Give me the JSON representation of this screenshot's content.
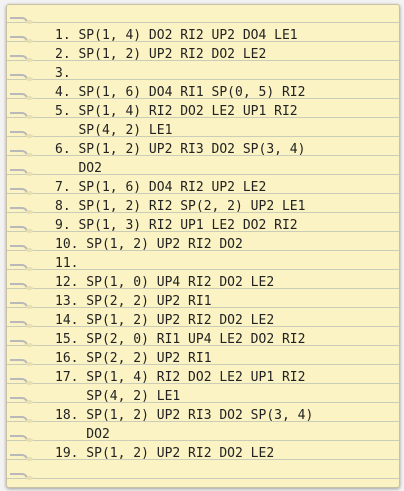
{
  "lines": [
    "1. SP(1, 4) DO2 RI2 UP2 DO4 LE1",
    "2. SP(1, 2) UP2 RI2 DO2 LE2",
    "3.",
    "4. SP(1, 6) DO4 RI1 SP(0, 5) RI2",
    "5. SP(1, 4) RI2 DO2 LE2 UP1 RI2",
    "   SP(4, 2) LE1",
    "6. SP(1, 2) UP2 RI3 DO2 SP(3, 4)",
    "   DO2",
    "7. SP(1, 6) DO4 RI2 UP2 LE2",
    "8. SP(1, 2) RI2 SP(2, 2) UP2 LE1",
    "9. SP(1, 3) RI2 UP1 LE2 DO2 RI2",
    "10. SP(1, 2) UP2 RI2 DO2",
    "11.",
    "12. SP(1, 0) UP4 RI2 DO2 LE2",
    "13. SP(2, 2) UP2 RI1",
    "14. SP(1, 2) UP2 RI2 DO2 LE2",
    "15. SP(2, 0) RI1 UP4 LE2 DO2 RI2",
    "16. SP(2, 2) UP2 RI1",
    "17. SP(1, 4) RI2 DO2 LE2 UP1 RI2",
    "    SP(4, 2) LE1",
    "18. SP(1, 2) UP2 RI3 DO2 SP(3, 4)",
    "    DO2",
    "19. SP(1, 2) UP2 RI2 DO2 LE2"
  ]
}
